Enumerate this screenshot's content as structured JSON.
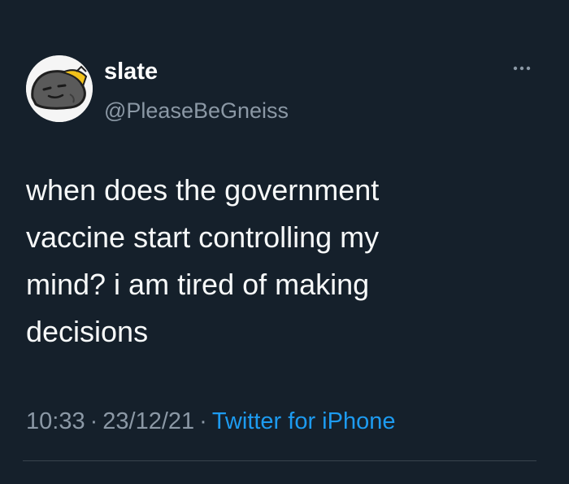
{
  "tweet": {
    "display_name": "slate",
    "handle": "@PleaseBeGneiss",
    "text": "when does the government\nvaccine start controlling my\nmind? i am tired of making\ndecisions",
    "time": "10:33",
    "separator": "·",
    "date": "23/12/21",
    "source": "Twitter for iPhone",
    "more_icon": "more-horizontal-icon"
  },
  "colors": {
    "background": "#15202b",
    "text": "#f7f9f9",
    "secondary": "#8b98a5",
    "accent": "#1d9bf0",
    "divider": "#38444d"
  }
}
